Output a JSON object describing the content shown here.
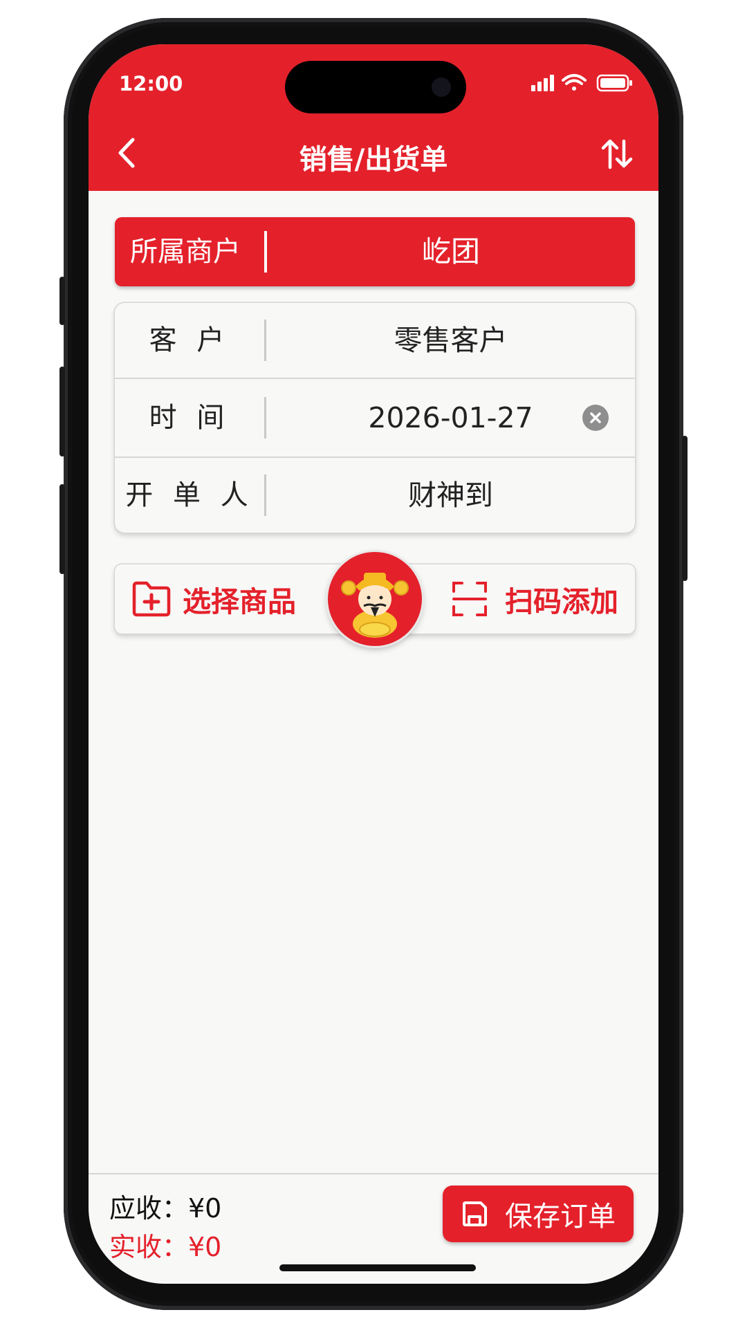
{
  "status_bar": {
    "time": "12:00"
  },
  "nav": {
    "title": "销售/出货单",
    "back_icon": "chevron-left-icon",
    "sort_icon": "sort-arrows-icon"
  },
  "merchant": {
    "label": "所属商户",
    "value": "屹团"
  },
  "form": {
    "customer_label": "客 户",
    "customer_value": "零售客户",
    "time_label": "时 间",
    "time_value": "2026-01-27",
    "operator_label": "开 单 人",
    "operator_value": "财神到"
  },
  "actions": {
    "select_goods_label": "选择商品",
    "scan_add_label": "扫码添加"
  },
  "footer": {
    "due_text": "应收：¥0",
    "paid_text": "实收：¥0",
    "save_label": "保存订单"
  },
  "colors": {
    "brand": "#e4212b",
    "background": "#f8f8f7"
  }
}
